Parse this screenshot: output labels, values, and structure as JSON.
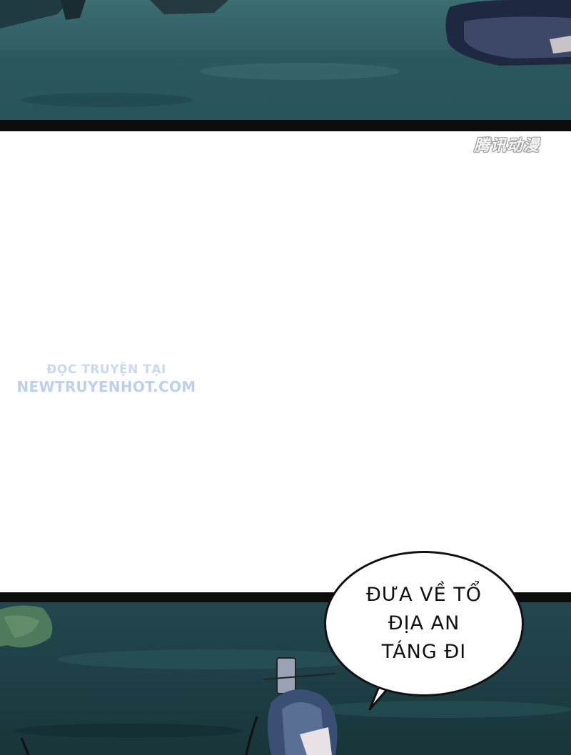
{
  "watermark_logo": "腾讯动漫",
  "site_watermark": {
    "line1": "ĐỌC TRUYỆN TẠI",
    "line2": "NEWTRUYENHOT.COM"
  },
  "speech_bubble": {
    "lines": [
      "ĐƯA VỀ TỔ",
      "ĐỊA AN",
      "TÁNG ĐI"
    ]
  },
  "colors": {
    "panel_top": "#2e5c62",
    "panel_bottom": "#1d3f45",
    "border": "#0c0c0c",
    "watermark_blue": "#bed0ea"
  }
}
